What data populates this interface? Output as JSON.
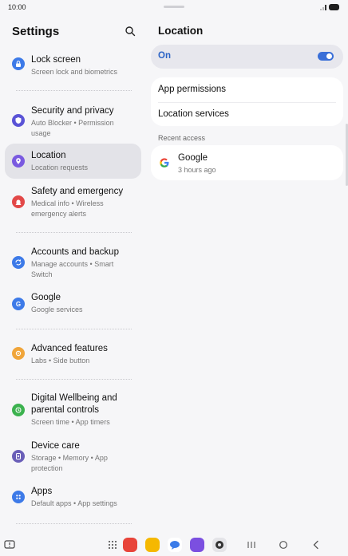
{
  "status_bar": {
    "time": "10:00"
  },
  "left_panel": {
    "title": "Settings",
    "items": [
      {
        "title": "Lock screen",
        "subtitle": "Screen lock and biometrics",
        "icon": "lock-icon",
        "color": "#3d7ae8"
      },
      {
        "title": "Security and privacy",
        "subtitle": "Auto Blocker  •  Permission usage",
        "icon": "shield-icon",
        "color": "#5a53d6"
      },
      {
        "title": "Location",
        "subtitle": "Location requests",
        "icon": "location-pin-icon",
        "color": "#7a5ae0"
      },
      {
        "title": "Safety and emergency",
        "subtitle": "Medical info  •  Wireless emergency alerts",
        "icon": "emergency-icon",
        "color": "#e24848"
      },
      {
        "title": "Accounts and backup",
        "subtitle": "Manage accounts  •  Smart Switch",
        "icon": "sync-icon",
        "color": "#3d7ae8"
      },
      {
        "title": "Google",
        "subtitle": "Google services",
        "icon": "google-icon",
        "color": "#3d7ae8"
      },
      {
        "title": "Advanced features",
        "subtitle": "Labs  •  Side button",
        "icon": "star-gear-icon",
        "color": "#f0a53a"
      },
      {
        "title": "Digital Wellbeing and parental controls",
        "subtitle": "Screen time  •  App timers",
        "icon": "wellbeing-icon",
        "color": "#3cb24f"
      },
      {
        "title": "Device care",
        "subtitle": "Storage  •  Memory  •  App protection",
        "icon": "device-care-icon",
        "color": "#6a5fb8"
      },
      {
        "title": "Apps",
        "subtitle": "Default apps  •  App settings",
        "icon": "apps-grid-icon",
        "color": "#3d7ae8"
      }
    ]
  },
  "right_panel": {
    "title": "Location",
    "toggle_label": "On",
    "toggle_on": true,
    "links": [
      "App permissions",
      "Location services"
    ],
    "recent_header": "Recent access",
    "recent": [
      {
        "app": "Google",
        "time": "3 hours ago",
        "icon": "google-g-icon"
      }
    ]
  },
  "nav_bar": {
    "dock_apps": [
      {
        "name": "app-drawer-icon",
        "color": "#444444"
      },
      {
        "name": "red-app-icon",
        "color": "#e8443a"
      },
      {
        "name": "notes-app-icon",
        "color": "#f5b800"
      },
      {
        "name": "messages-app-icon",
        "color": "#3a7be8"
      },
      {
        "name": "internet-app-icon",
        "color": "#7b4fe0"
      },
      {
        "name": "camera-app-icon",
        "color": "#333333"
      }
    ]
  }
}
